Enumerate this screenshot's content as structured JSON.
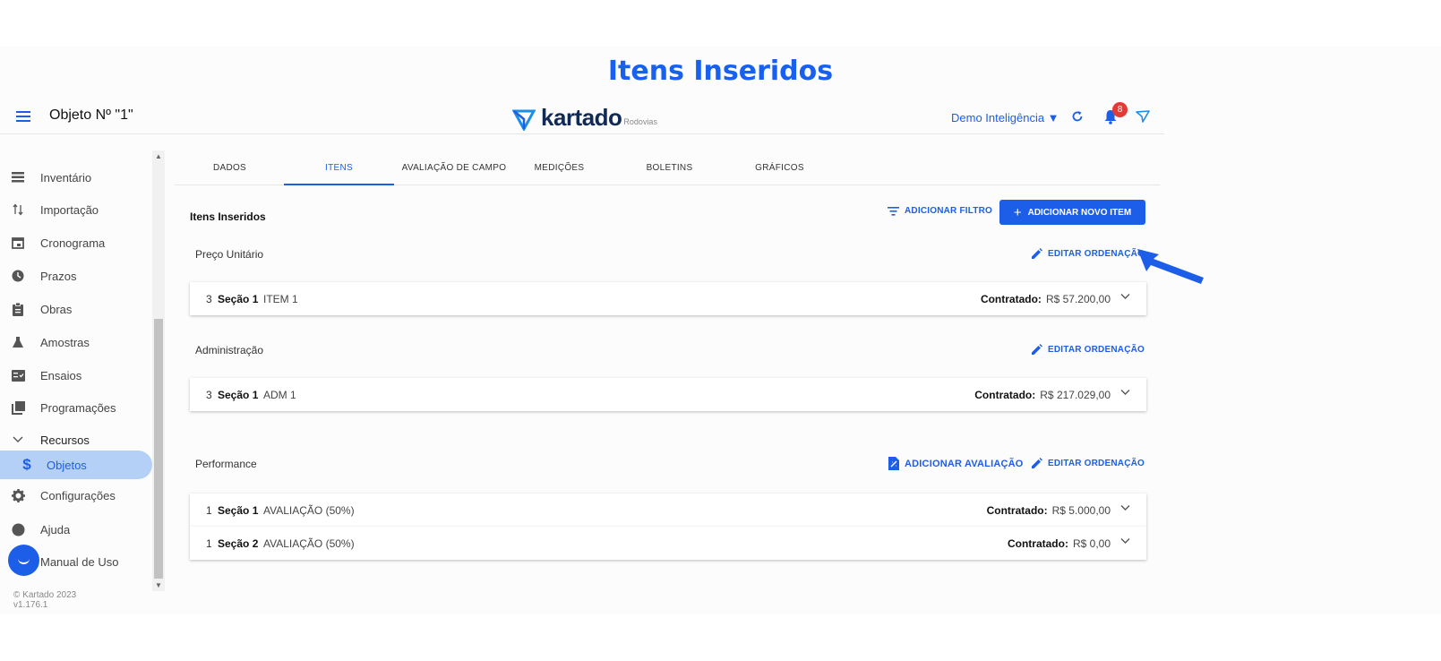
{
  "slide_title": "Itens Inseridos",
  "header": {
    "object_title": "Objeto Nº \"1\"",
    "brand": "kartado",
    "brand_sub": "Rodovias",
    "user": "Demo Inteligência ▼",
    "notification_count": "8"
  },
  "sidebar": {
    "items": [
      {
        "label": "Inventário",
        "icon": "list-icon"
      },
      {
        "label": "Importação",
        "icon": "import-icon"
      },
      {
        "label": "Cronograma",
        "icon": "calendar-icon"
      },
      {
        "label": "Prazos",
        "icon": "clock-icon"
      },
      {
        "label": "Obras",
        "icon": "clipboard-icon"
      },
      {
        "label": "Amostras",
        "icon": "flask-icon"
      },
      {
        "label": "Ensaios",
        "icon": "checklist-icon"
      },
      {
        "label": "Programações",
        "icon": "book-icon"
      },
      {
        "label": "Recursos",
        "icon": "chevron-down-icon"
      },
      {
        "label": "Objetos",
        "icon": "dollar-icon"
      },
      {
        "label": "Configurações",
        "icon": "gear-icon"
      },
      {
        "label": "Ajuda",
        "icon": "help-icon"
      },
      {
        "label": "Manual de Uso",
        "icon": "manual-icon"
      }
    ],
    "copyright": "© Kartado 2023",
    "version": "v1.176.1"
  },
  "tabs": [
    "DADOS",
    "ITENS",
    "AVALIAÇÃO DE CAMPO",
    "MEDIÇÕES",
    "BOLETINS",
    "GRÁFICOS"
  ],
  "content": {
    "heading": "Itens Inseridos",
    "add_filter": "ADICIONAR FILTRO",
    "add_item": "ADICIONAR NOVO ITEM",
    "edit_order": "EDITAR ORDENAÇÃO",
    "add_evaluation": "ADICIONAR AVALIAÇÃO",
    "contracted_label": "Contratado:",
    "groups": [
      {
        "label": "Preço Unitário",
        "rows": [
          {
            "num": "3",
            "section": "Seção 1",
            "name": "ITEM 1",
            "value": "R$ 57.200,00"
          }
        ]
      },
      {
        "label": "Administração",
        "rows": [
          {
            "num": "3",
            "section": "Seção 1",
            "name": "ADM 1",
            "value": "R$ 217.029,00"
          }
        ]
      },
      {
        "label": "Performance",
        "rows": [
          {
            "num": "1",
            "section": "Seção 1",
            "name": "AVALIAÇÃO (50%)",
            "value": "R$ 5.000,00"
          },
          {
            "num": "1",
            "section": "Seção 2",
            "name": "AVALIAÇÃO (50%)",
            "value": "R$ 0,00"
          }
        ]
      }
    ]
  },
  "colors": {
    "accent": "#1d5ee8",
    "title": "#1760f0",
    "badge": "#e53935",
    "active_bg": "#b5d0f6"
  }
}
